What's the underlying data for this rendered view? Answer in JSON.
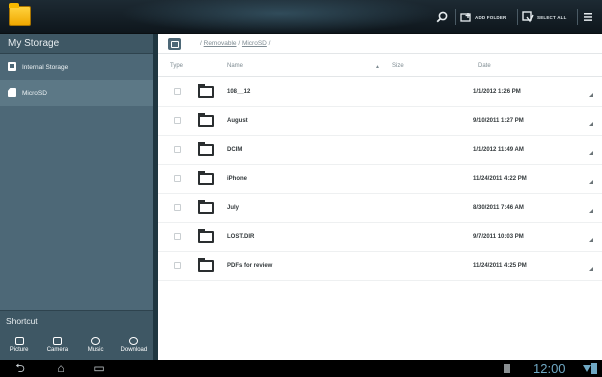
{
  "actionbar": {
    "add_folder_label": "ADD FOLDER",
    "select_all_label": "SELECT ALL",
    "icons": [
      "search-icon",
      "add-folder-icon",
      "select-all-icon",
      "menu-icon"
    ]
  },
  "sidebar": {
    "header": "My Storage",
    "items": [
      {
        "label": "Internal Storage",
        "icon": "phone-icon"
      },
      {
        "label": "MicroSD",
        "icon": "sdcard-icon"
      }
    ],
    "shortcut_header": "Shortcut",
    "shortcuts": [
      {
        "label": "Picture",
        "icon": "picture-icon"
      },
      {
        "label": "Camera",
        "icon": "camera-icon"
      },
      {
        "label": "Music",
        "icon": "music-icon"
      },
      {
        "label": "Download",
        "icon": "download-icon"
      }
    ]
  },
  "main": {
    "path_prefix": "/ ",
    "path_segments": [
      "Removable",
      "MicroSD"
    ],
    "path_suffix": " /",
    "columns": {
      "type": "Type",
      "name": "Name",
      "size": "Size",
      "date": "Date",
      "sort_indicator": "▲"
    },
    "rows": [
      {
        "name": "108__12",
        "date": "1/1/2012 1:26 PM"
      },
      {
        "name": "August",
        "date": "9/10/2011 1:27 PM"
      },
      {
        "name": "DCIM",
        "date": "1/1/2012 11:49 AM"
      },
      {
        "name": "iPhone",
        "date": "11/24/2011 4:22 PM"
      },
      {
        "name": "July",
        "date": "8/30/2011 7:46 AM"
      },
      {
        "name": "LOST.DIR",
        "date": "9/7/2011 10:03 PM"
      },
      {
        "name": "PDFs for review",
        "date": "11/24/2011 4:25 PM"
      }
    ]
  },
  "system": {
    "clock": "12:00",
    "nav": {
      "back": "⮌",
      "home": "⌂",
      "recents": "▭"
    }
  },
  "colors": {
    "sidebar": "#4d6877",
    "accent": "#6fa8c4"
  }
}
